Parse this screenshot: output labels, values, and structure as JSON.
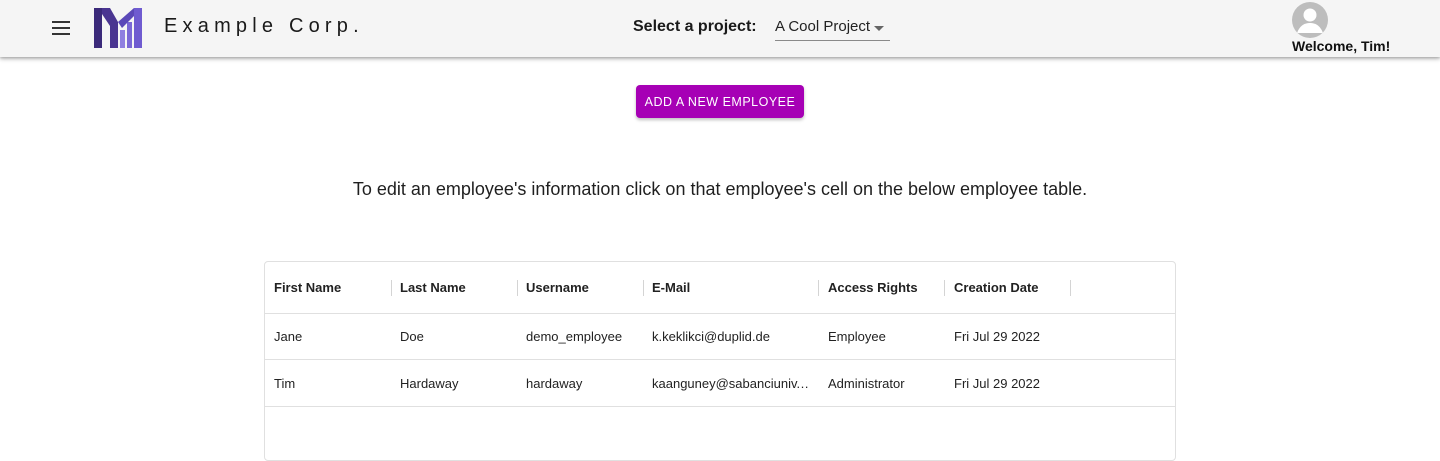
{
  "header": {
    "brand": "Example Corp.",
    "project_label": "Select a project:",
    "project_value": "A Cool Project",
    "welcome": "Welcome, Tim!"
  },
  "actions": {
    "add_employee": "ADD A NEW EMPLOYEE"
  },
  "instructions": "To edit an employee's information click on that employee's cell on the below employee table.",
  "table": {
    "columns": [
      "First Name",
      "Last Name",
      "Username",
      "E-Mail",
      "Access Rights",
      "Creation Date"
    ],
    "rows": [
      [
        "Jane",
        "Doe",
        "demo_employee",
        "k.keklikci@duplid.de",
        "Employee",
        "Fri Jul 29 2022"
      ],
      [
        "Tim",
        "Hardaway",
        "hardaway",
        "kaanguney@sabanciuniv.…",
        "Administrator",
        "Fri Jul 29 2022"
      ]
    ]
  },
  "colors": {
    "accent": "#a600b5",
    "appbar": "#f5f5f5",
    "logo_dark": "#3b2a7a",
    "logo_light": "#8f7fe0"
  },
  "icons": {
    "menu": "menu-icon",
    "logo": "company-logo",
    "avatar": "account-circle-icon",
    "dropdown": "caret-down-icon"
  }
}
